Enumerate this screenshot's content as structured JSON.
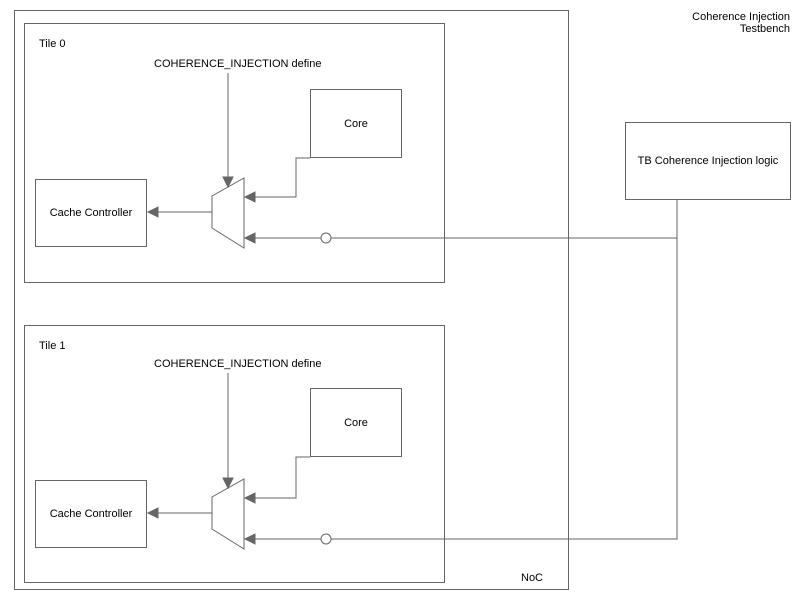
{
  "title": "Coherence Injection Testbench",
  "noc_label": "NoC",
  "tb_block": "TB Coherence Injection logic",
  "tiles": [
    {
      "name": "Tile 0",
      "define": "COHERENCE_INJECTION define",
      "core": "Core",
      "cache": "Cache Controller"
    },
    {
      "name": "Tile 1",
      "define": "COHERENCE_INJECTION define",
      "core": "Core",
      "cache": "Cache Controller"
    }
  ]
}
